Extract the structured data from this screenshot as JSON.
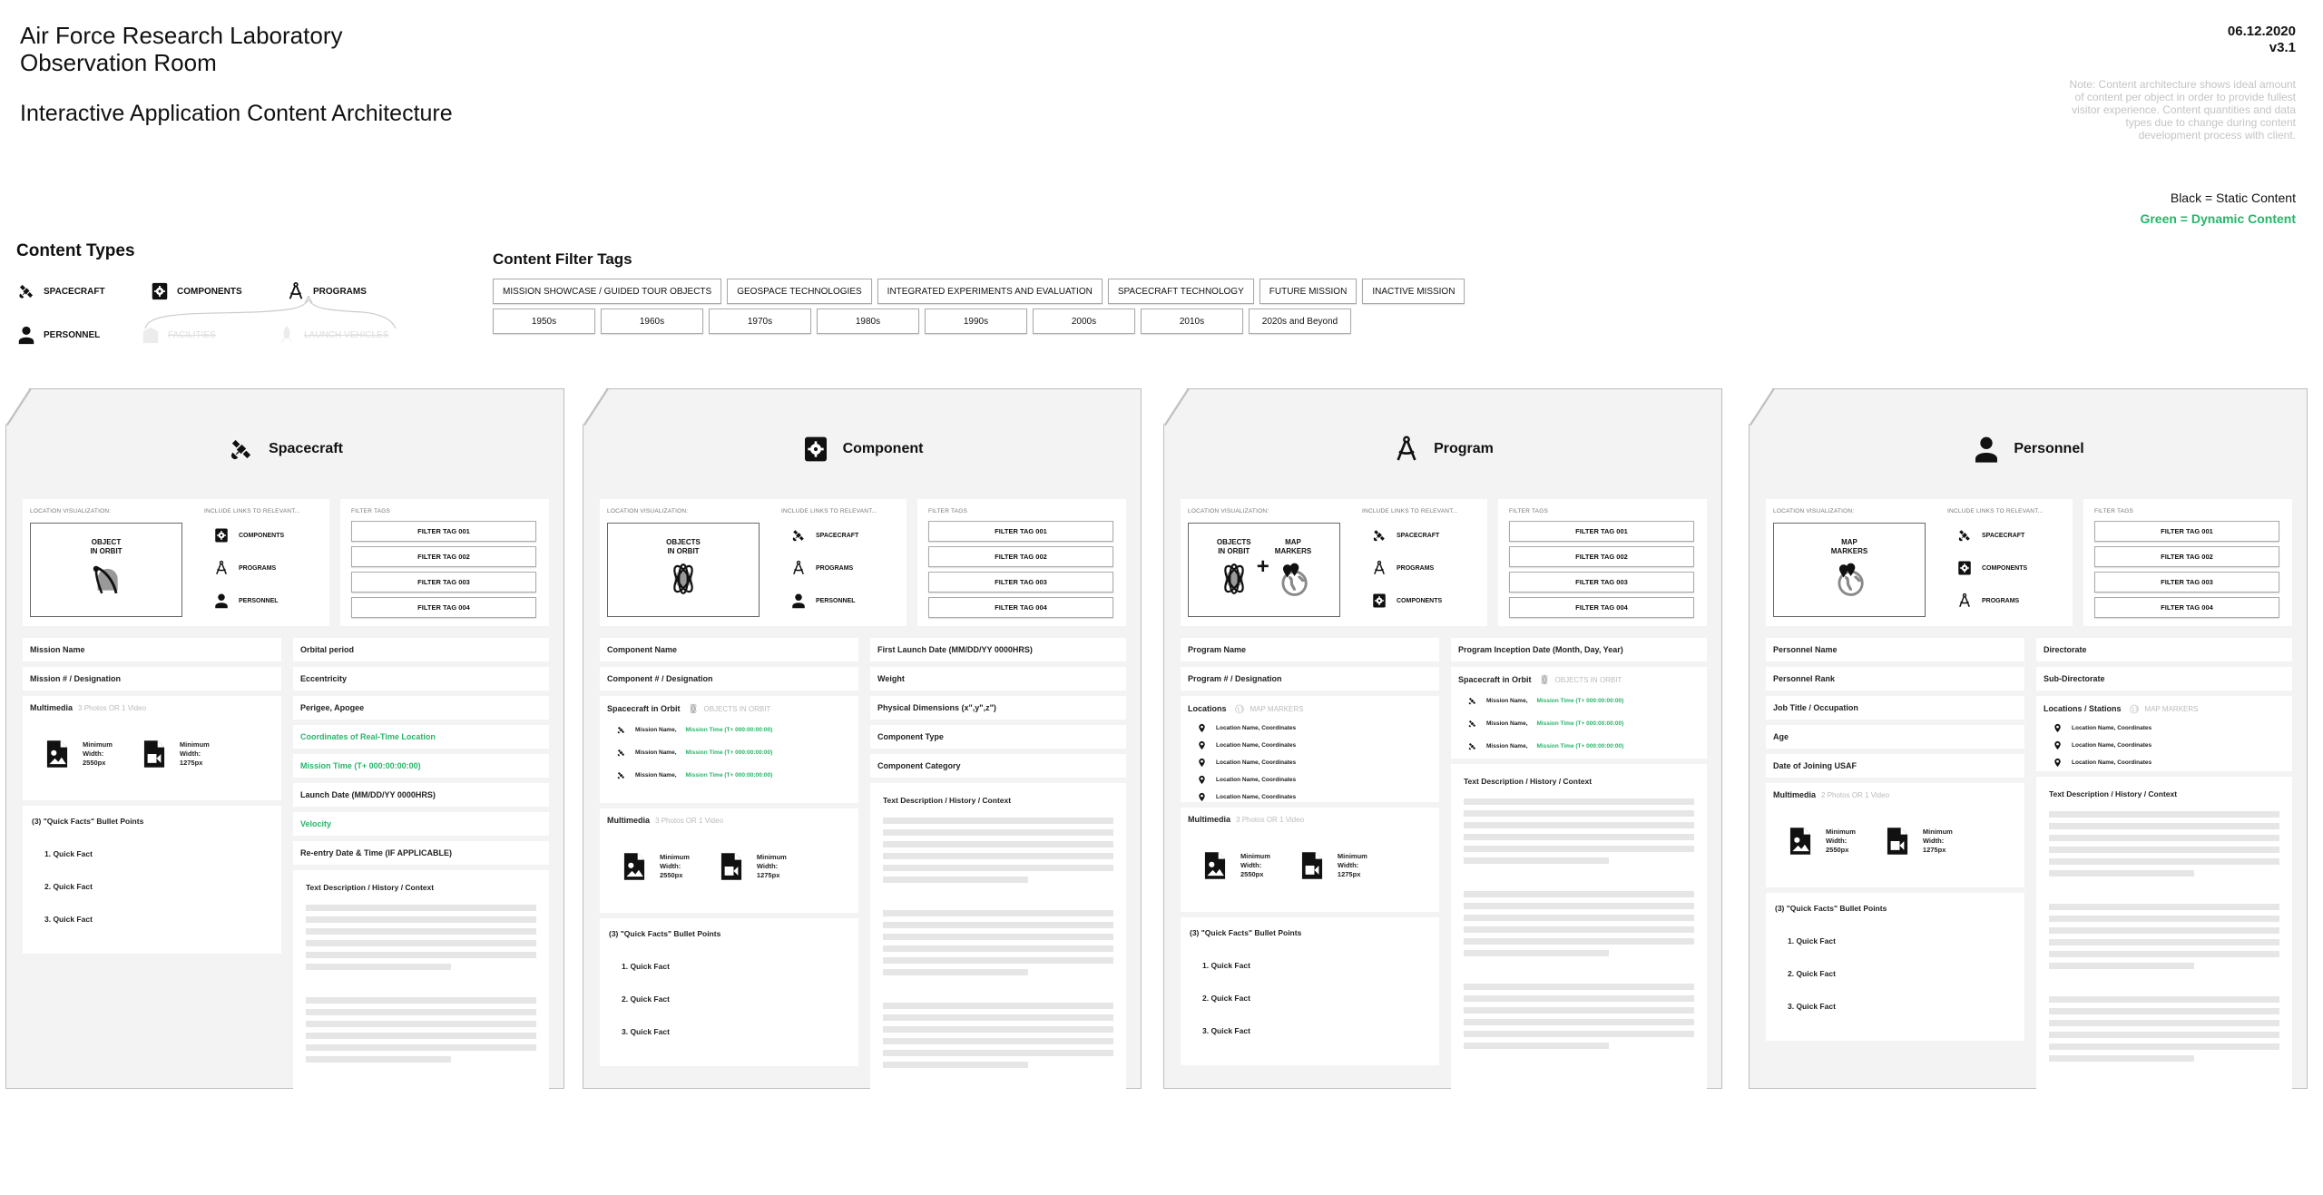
{
  "header": {
    "title_line1": "Air Force Research Laboratory",
    "title_line2": "Observation Room",
    "subtitle": "Interactive Application Content Architecture",
    "date": "06.12.2020",
    "version": "v3.1",
    "note": "Note: Content architecture shows ideal amount of content per object in order to provide fullest visitor experience. Content quantities and data types due to change during content development process with client.",
    "legend_static": "Black = Static Content",
    "legend_dynamic": "Green = Dynamic Content"
  },
  "colors": {
    "dynamic": "#27b56a",
    "muted": "#bbbbbb",
    "card_bg": "#f3f3f3"
  },
  "content_types": {
    "heading": "Content Types",
    "items": [
      {
        "label": "SPACECRAFT",
        "icon": "satellite-icon"
      },
      {
        "label": "COMPONENTS",
        "icon": "gear-icon"
      },
      {
        "label": "PROGRAMS",
        "icon": "compass-icon"
      },
      {
        "label": "PERSONNEL",
        "icon": "person-icon"
      },
      {
        "label": "FACILITIES",
        "icon": "building-icon",
        "deprecated": true
      },
      {
        "label": "LAUNCH VEHICLES",
        "icon": "rocket-icon",
        "deprecated": true
      }
    ]
  },
  "filter_tags": {
    "heading": "Content Filter Tags",
    "categories": [
      "MISSION SHOWCASE / GUIDED TOUR OBJECTS",
      "GEOSPACE TECHNOLOGIES",
      "INTEGRATED EXPERIMENTS AND EVALUATION",
      "SPACECRAFT TECHNOLOGY",
      "FUTURE MISSION",
      "INACTIVE MISSION"
    ],
    "decades": [
      "1950s",
      "1960s",
      "1970s",
      "1980s",
      "1990s",
      "2000s",
      "2010s",
      "2020s and Beyond"
    ]
  },
  "cards": [
    {
      "title": "Spacecraft",
      "icon": "satellite-icon",
      "location_label": "LOCATION VISUALIZATION:",
      "viz": [
        {
          "label": "OBJECT\nIN ORBIT",
          "icon": "orbit-single-icon"
        }
      ],
      "links_label": "INCLUDE LINKS TO RELEVANT...",
      "links": [
        {
          "label": "COMPONENTS",
          "icon": "gear-icon"
        },
        {
          "label": "PROGRAMS",
          "icon": "compass-icon"
        },
        {
          "label": "PERSONNEL",
          "icon": "person-icon"
        }
      ],
      "filter_label": "FILTER TAGS",
      "filter_tags": [
        "FILTER TAG 001",
        "FILTER TAG 002",
        "FILTER TAG 003",
        "FILTER TAG 004"
      ],
      "left": [
        {
          "type": "field",
          "label": "Mission Name"
        },
        {
          "type": "field",
          "label": "Mission # / Designation"
        },
        {
          "type": "multimedia",
          "label": "Multimedia",
          "hint": "3 Photos OR 1 Video",
          "items": [
            {
              "icon": "image-file-icon",
              "lines": [
                "Minimum",
                "Width:",
                "2550px"
              ]
            },
            {
              "icon": "video-file-icon",
              "lines": [
                "Minimum",
                "Width:",
                "1275px"
              ]
            }
          ]
        },
        {
          "type": "quickfacts",
          "label": "(3) \"Quick Facts\" Bullet Points",
          "facts": [
            "1. Quick Fact",
            "2. Quick Fact",
            "3. Quick Fact"
          ]
        }
      ],
      "right": [
        {
          "type": "field",
          "label": "Orbital period"
        },
        {
          "type": "field",
          "label": "Eccentricity"
        },
        {
          "type": "field",
          "label": "Perigee, Apogee"
        },
        {
          "type": "field",
          "label": "Coordinates of Real-Time Location",
          "dynamic": true
        },
        {
          "type": "field",
          "label": "Mission Time (T+ 000:00:00:00)",
          "dynamic": true
        },
        {
          "type": "field",
          "label": "Launch Date (MM/DD/YY  0000HRS)"
        },
        {
          "type": "field",
          "label": "Velocity",
          "dynamic": true
        },
        {
          "type": "field",
          "label": "Re-entry Date & Time (IF APPLICABLE)"
        },
        {
          "type": "text",
          "label": "Text Description / History / Context"
        }
      ]
    },
    {
      "title": "Component",
      "icon": "gear-icon",
      "location_label": "LOCATION VISUALIZATION:",
      "viz": [
        {
          "label": "OBJECTS\nIN ORBIT",
          "icon": "orbit-icon"
        }
      ],
      "links_label": "INCLUDE LINKS TO RELEVANT...",
      "links": [
        {
          "label": "SPACECRAFT",
          "icon": "satellite-icon"
        },
        {
          "label": "PROGRAMS",
          "icon": "compass-icon"
        },
        {
          "label": "PERSONNEL",
          "icon": "person-icon"
        }
      ],
      "filter_label": "FILTER TAGS",
      "filter_tags": [
        "FILTER TAG 001",
        "FILTER TAG 002",
        "FILTER TAG 003",
        "FILTER TAG 004"
      ],
      "left": [
        {
          "type": "field",
          "label": "Component Name"
        },
        {
          "type": "field",
          "label": "Component # / Designation"
        },
        {
          "type": "missions",
          "label": "Spacecraft in Orbit",
          "hint": "OBJECTS IN ORBIT",
          "items": [
            {
              "name": "Mission Name,",
              "time": "Mission Time (T+ 000:00:00:00)"
            },
            {
              "name": "Mission Name,",
              "time": "Mission Time (T+ 000:00:00:00)"
            },
            {
              "name": "Mission Name,",
              "time": "Mission Time (T+ 000:00:00:00)"
            }
          ]
        },
        {
          "type": "multimedia",
          "label": "Multimedia",
          "hint": "3 Photos OR 1 Video",
          "items": [
            {
              "icon": "image-file-icon",
              "lines": [
                "Minimum",
                "Width:",
                "2550px"
              ]
            },
            {
              "icon": "video-file-icon",
              "lines": [
                "Minimum",
                "Width:",
                "1275px"
              ]
            }
          ]
        },
        {
          "type": "quickfacts",
          "label": "(3) \"Quick Facts\" Bullet Points",
          "facts": [
            "1. Quick Fact",
            "2. Quick Fact",
            "3. Quick Fact"
          ]
        }
      ],
      "right": [
        {
          "type": "field",
          "label": "First Launch Date (MM/DD/YY  0000HRS)"
        },
        {
          "type": "field",
          "label": "Weight"
        },
        {
          "type": "field",
          "label": "Physical Dimensions (x\",y\",z\")"
        },
        {
          "type": "field",
          "label": "Component Type"
        },
        {
          "type": "field",
          "label": "Component Category"
        },
        {
          "type": "text",
          "label": "Text Description / History / Context"
        }
      ]
    },
    {
      "title": "Program",
      "icon": "compass-icon",
      "location_label": "LOCATION VISUALIZATION:",
      "viz": [
        {
          "label": "OBJECTS\nIN ORBIT",
          "icon": "orbit-icon"
        },
        {
          "label": "MAP\nMARKERS",
          "icon": "map-markers-icon"
        }
      ],
      "viz_joiner": "+",
      "links_label": "INCLUDE LINKS TO RELEVANT...",
      "links": [
        {
          "label": "SPACECRAFT",
          "icon": "satellite-icon"
        },
        {
          "label": "PROGRAMS",
          "icon": "compass-icon"
        },
        {
          "label": "COMPONENTS",
          "icon": "gear-icon"
        }
      ],
      "filter_label": "FILTER TAGS",
      "filter_tags": [
        "FILTER TAG 001",
        "FILTER TAG 002",
        "FILTER TAG 003",
        "FILTER TAG 004"
      ],
      "left": [
        {
          "type": "field",
          "label": "Program Name"
        },
        {
          "type": "field",
          "label": "Program # / Designation"
        },
        {
          "type": "locations",
          "label": "Locations",
          "hint": "MAP MARKERS",
          "items": [
            "Location Name, Coordinates",
            "Location Name, Coordinates",
            "Location Name, Coordinates",
            "Location Name, Coordinates",
            "Location Name, Coordinates"
          ]
        },
        {
          "type": "multimedia",
          "label": "Multimedia",
          "hint": "3 Photos OR 1 Video",
          "items": [
            {
              "icon": "image-file-icon",
              "lines": [
                "Minimum",
                "Width:",
                "2550px"
              ]
            },
            {
              "icon": "video-file-icon",
              "lines": [
                "Minimum",
                "Width:",
                "1275px"
              ]
            }
          ]
        },
        {
          "type": "quickfacts",
          "label": "(3) \"Quick Facts\" Bullet Points",
          "facts": [
            "1. Quick Fact",
            "2. Quick Fact",
            "3. Quick Fact"
          ]
        }
      ],
      "right": [
        {
          "type": "field",
          "label": "Program Inception Date (Month, Day, Year)"
        },
        {
          "type": "missions",
          "label": "Spacecraft in Orbit",
          "hint": "OBJECTS IN ORBIT",
          "items": [
            {
              "name": "Mission Name,",
              "time": "Mission Time (T+ 000:00:00:00)"
            },
            {
              "name": "Mission Name,",
              "time": "Mission Time (T+ 000:00:00:00)"
            },
            {
              "name": "Mission Name,",
              "time": "Mission Time (T+ 000:00:00:00)"
            }
          ]
        },
        {
          "type": "text",
          "label": "Text Description / History / Context"
        }
      ]
    },
    {
      "title": "Personnel",
      "icon": "person-icon",
      "location_label": "LOCATION VISUALIZATION:",
      "viz": [
        {
          "label": "MAP\nMARKERS",
          "icon": "map-markers-icon"
        }
      ],
      "links_label": "INCLUDE LINKS TO RELEVANT...",
      "links": [
        {
          "label": "SPACECRAFT",
          "icon": "satellite-icon"
        },
        {
          "label": "COMPONENTS",
          "icon": "gear-icon"
        },
        {
          "label": "PROGRAMS",
          "icon": "compass-icon"
        }
      ],
      "filter_label": "FILTER TAGS",
      "filter_tags": [
        "FILTER TAG 001",
        "FILTER TAG 002",
        "FILTER TAG 003",
        "FILTER TAG 004"
      ],
      "left": [
        {
          "type": "field",
          "label": "Personnel Name"
        },
        {
          "type": "field",
          "label": "Personnel Rank"
        },
        {
          "type": "field",
          "label": "Job Title / Occupation"
        },
        {
          "type": "field",
          "label": "Age"
        },
        {
          "type": "field",
          "label": "Date of Joining USAF"
        },
        {
          "type": "multimedia",
          "label": "Multimedia",
          "hint": "2 Photos OR 1 Video",
          "items": [
            {
              "icon": "image-file-icon",
              "lines": [
                "Minimum",
                "Width:",
                "2550px"
              ]
            },
            {
              "icon": "video-file-icon",
              "lines": [
                "Minimum",
                "Width:",
                "1275px"
              ]
            }
          ]
        },
        {
          "type": "quickfacts",
          "label": "(3) \"Quick Facts\" Bullet Points",
          "facts": [
            "1. Quick Fact",
            "2. Quick Fact",
            "3. Quick Fact"
          ]
        }
      ],
      "right": [
        {
          "type": "field",
          "label": "Directorate"
        },
        {
          "type": "field",
          "label": "Sub-Directorate"
        },
        {
          "type": "locations",
          "label": "Locations / Stations",
          "hint": "MAP MARKERS",
          "items": [
            "Location Name, Coordinates",
            "Location Name, Coordinates",
            "Location Name, Coordinates"
          ]
        },
        {
          "type": "text",
          "label": "Text Description / History / Context"
        }
      ]
    }
  ]
}
